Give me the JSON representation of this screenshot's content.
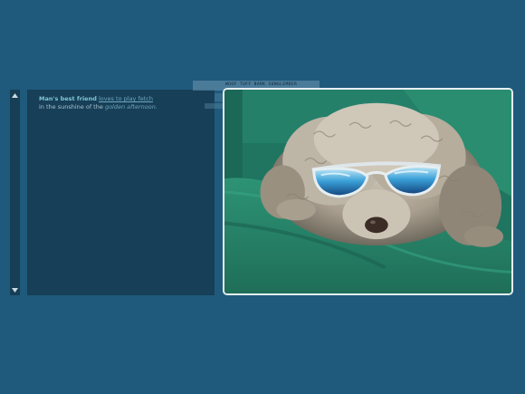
{
  "scrollbar": {
    "up_icon": "triangle-up-icon",
    "down_icon": "triangle-down-icon"
  },
  "caption": {
    "bold_text": "Man's best friend",
    "link_text": "loves to play fetch",
    "plain_text": "in the sunshine of the",
    "italic_text": "golden afternoon."
  },
  "ticker": {
    "text": "WOOF  TUFF  BARK  SUNGLEMDER"
  },
  "photo": {
    "subject": "dog-wearing-sunglasses-image",
    "colors": {
      "cushion": "#2f8a6f",
      "frame_border": "#e6eef2",
      "lens": "#3aa0d8"
    }
  }
}
